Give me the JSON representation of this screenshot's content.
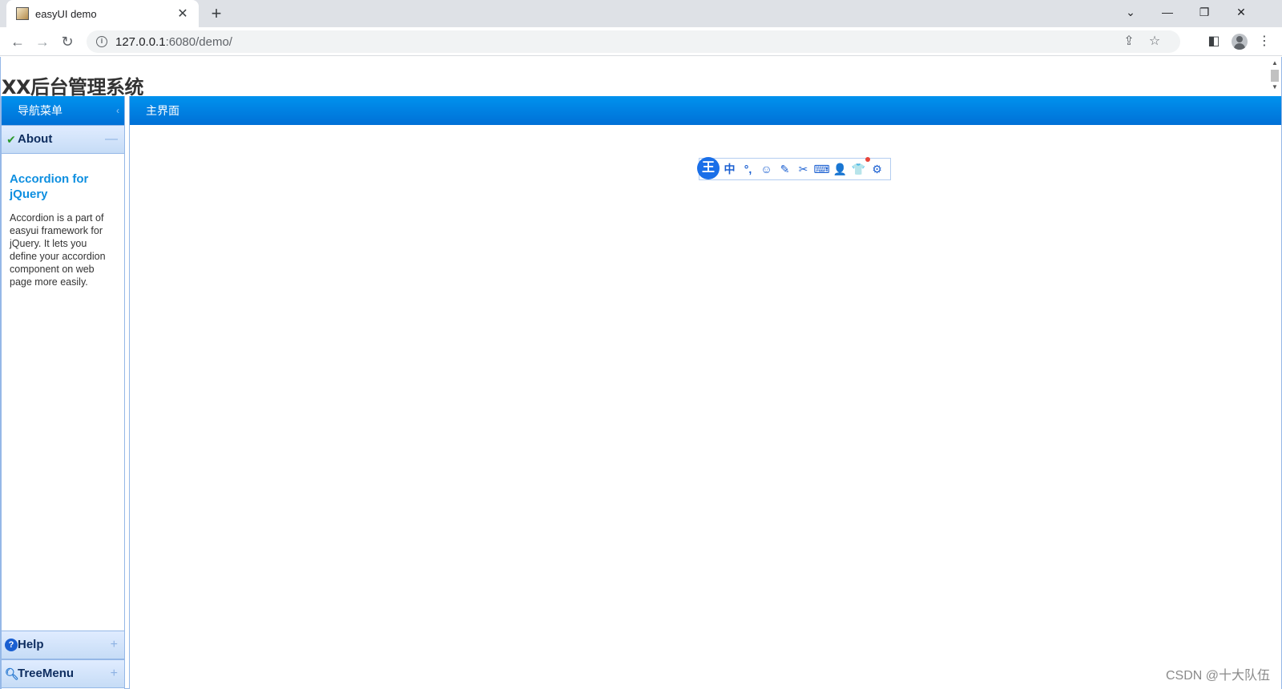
{
  "browser": {
    "tab_title": "easyUI demo",
    "tab_close": "✕",
    "new_tab": "+",
    "url_host": "127.0.0.1",
    "url_rest": ":6080/demo/",
    "win_dropdown": "⌄",
    "win_minimize": "—",
    "win_restore": "❐",
    "win_close": "✕"
  },
  "page": {
    "title": "XX后台管理系统"
  },
  "west": {
    "header": "导航菜单",
    "collapse": "‹",
    "accordion": [
      {
        "label": "About",
        "icon": "check-icon",
        "tool": "—"
      },
      {
        "label": "Help",
        "icon": "help-icon",
        "tool": "+"
      },
      {
        "label": "TreeMenu",
        "icon": "search-icon",
        "tool": "+"
      }
    ],
    "about_body": {
      "heading": "Accordion for jQuery",
      "text": "Accordion is a part of easyui framework for jQuery. It lets you define your accordion component on web page more easily."
    }
  },
  "center": {
    "header": "主界面"
  },
  "ime": {
    "logo": "王",
    "items": [
      "中",
      "°,",
      "☺",
      "✎",
      "✂",
      "⌨",
      "👤",
      "👕",
      "⚙"
    ]
  },
  "watermark": "CSDN @十大队伍",
  "colors": {
    "panel_header": "#0080e6",
    "accordion_header": "#d4e5fb",
    "border": "#95b8e7"
  }
}
